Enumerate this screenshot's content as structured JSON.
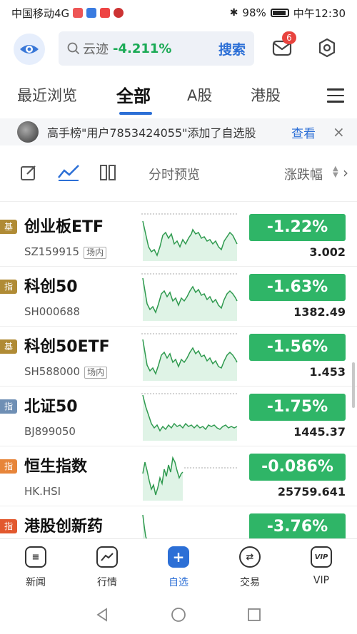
{
  "status_bar": {
    "carrier": "中国移动4G",
    "net_label": "4G",
    "battery": "98%",
    "time": "中午12:30"
  },
  "top_bar": {
    "search_stock_name": "云迹",
    "search_stock_change": "-4.211%",
    "search_button": "搜索",
    "message_badge": "6"
  },
  "tabs": [
    {
      "label": "最近浏览"
    },
    {
      "label": "全部"
    },
    {
      "label": "A股"
    },
    {
      "label": "港股"
    }
  ],
  "notice": {
    "text": "高手榜\"用户7853424055\"添加了自选股",
    "view_label": "查看",
    "close": "×"
  },
  "toolbar": {
    "mode_label": "分时预览",
    "sort_label": "涨跌幅"
  },
  "rows": [
    {
      "tag": "基",
      "name": "创业板ETF",
      "code": "SZ159915",
      "market": "场内",
      "change": "-1.22%",
      "price": "3.002"
    },
    {
      "tag": "指",
      "name": "科创50",
      "code": "SH000688",
      "market": "",
      "change": "-1.63%",
      "price": "1382.49"
    },
    {
      "tag": "基",
      "name": "科创50ETF",
      "code": "SH588000",
      "market": "场内",
      "change": "-1.56%",
      "price": "1.453"
    },
    {
      "tag": "指",
      "name": "北证50",
      "code": "BJ899050",
      "market": "",
      "change": "-1.75%",
      "price": "1445.37"
    },
    {
      "tag": "指",
      "name": "恒生指数",
      "code": "HK.HSI",
      "market": "",
      "change": "-0.086%",
      "price": "25759.641"
    },
    {
      "tag": "指",
      "name": "港股创新药",
      "code": "",
      "market": "",
      "change": "-3.76%",
      "price": ""
    }
  ],
  "bottom_nav": [
    {
      "label": "新闻",
      "icon": "news-icon"
    },
    {
      "label": "行情",
      "icon": "market-chart-icon"
    },
    {
      "label": "自选",
      "icon": "plus-icon"
    },
    {
      "label": "交易",
      "icon": "exchange-icon"
    },
    {
      "label": "VIP",
      "icon": "vip-icon"
    }
  ],
  "colors": {
    "accent": "#2c6fd6",
    "down_green": "#2fb567",
    "badge_red": "#e8433e"
  }
}
